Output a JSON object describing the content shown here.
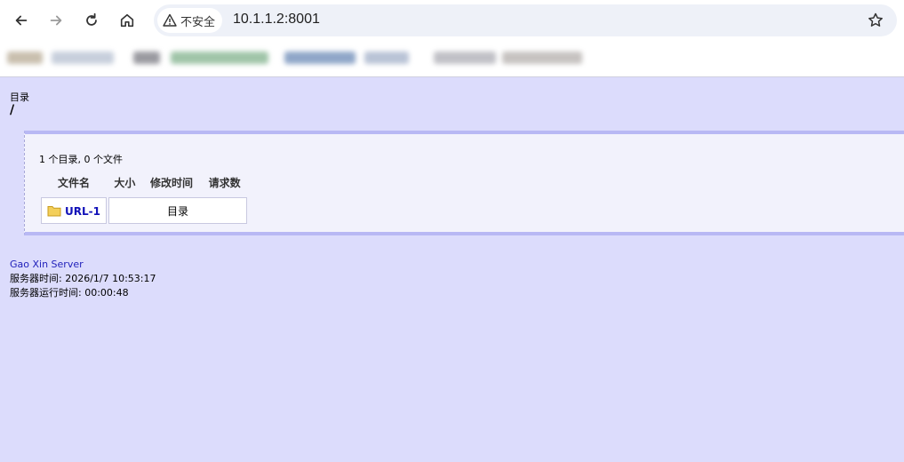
{
  "browser": {
    "security_label": "不安全",
    "url": "10.1.1.2:8001"
  },
  "page": {
    "dir_label": "目录",
    "dir_path": "/",
    "summary": "1 个目录, 0 个文件",
    "columns": [
      "文件名",
      "大小",
      "修改时间",
      "请求数"
    ],
    "rows": [
      {
        "name": "URL-1",
        "type": "目录",
        "icon": "folder-icon"
      }
    ],
    "footer": {
      "server_name": "Gao Xin Server",
      "server_time": "服务器时间: 2026/1/7 10:53:17",
      "uptime": "服务器运行时间: 00:00:48"
    }
  }
}
